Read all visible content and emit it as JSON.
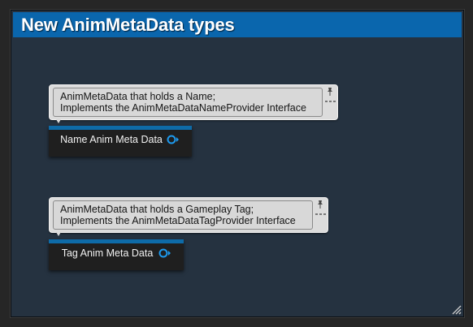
{
  "comment": {
    "title": "New AnimMetaData types",
    "header_color": "#0a66ad"
  },
  "nodes": [
    {
      "title": "Name Anim Meta Data",
      "output_pin": "object-output-pin-icon",
      "bubble": {
        "line1": "AnimMetaData that holds a Name;",
        "line2": "Implements the AnimMetaDataNameProvider Interface"
      }
    },
    {
      "title": "Tag Anim Meta Data",
      "output_pin": "object-output-pin-icon",
      "bubble": {
        "line1": "AnimMetaData that holds a Gameplay Tag;",
        "line2": "Implements the AnimMetaDataTagProvider Interface"
      }
    }
  ],
  "icons": {
    "bubble_pin": "pushpin-icon",
    "bubble_size": "resize-bubble-icon",
    "comment_resize": "resize-grip-icon"
  },
  "colors": {
    "node_title_bar": "#0e6ba8",
    "pin": "#1d9bf0"
  }
}
